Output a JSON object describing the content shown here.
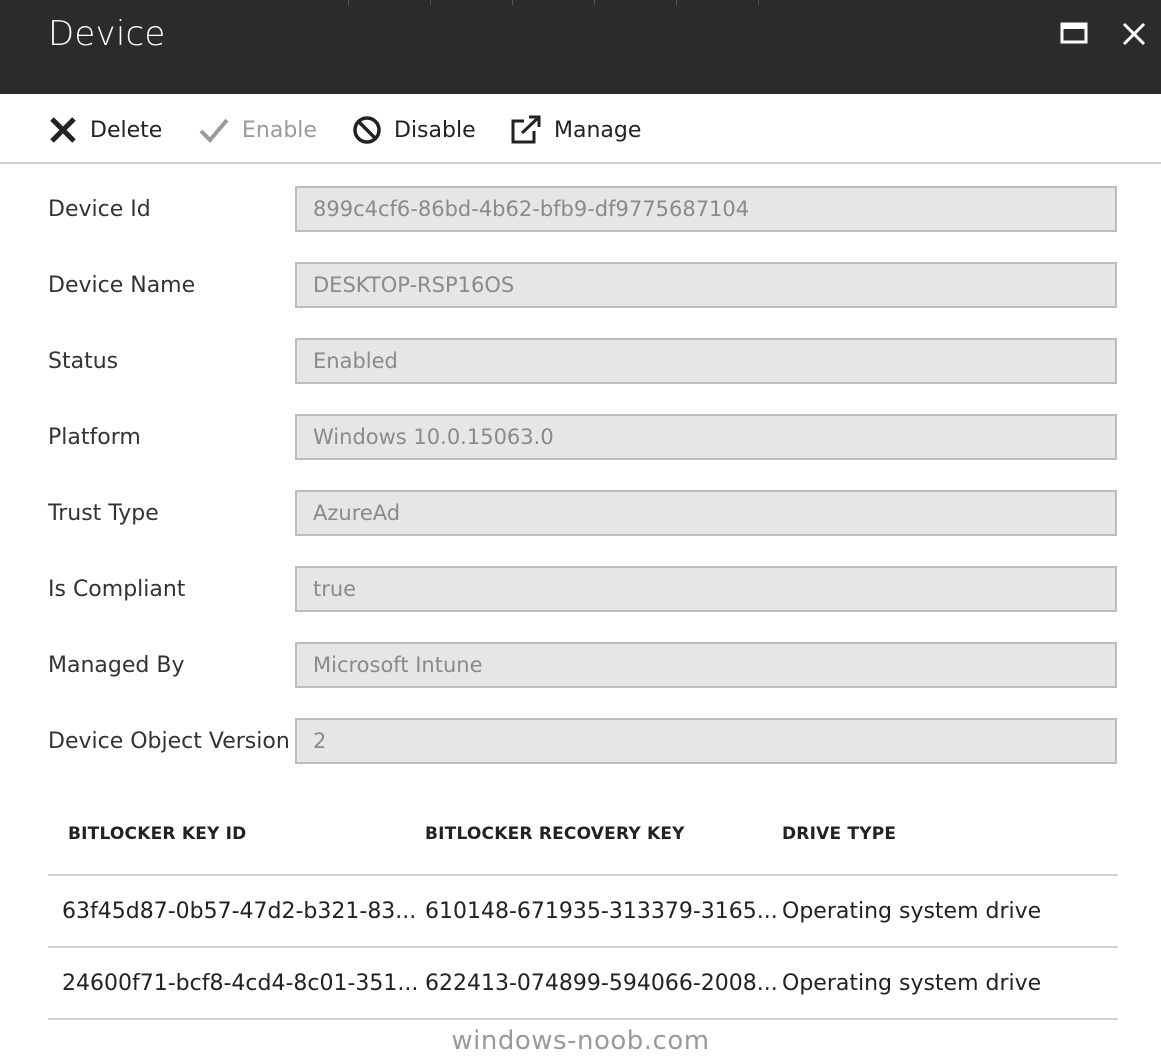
{
  "window": {
    "title": "Device",
    "maximize_icon": "maximize-icon",
    "close_icon": "close-icon"
  },
  "toolbar": {
    "delete_label": "Delete",
    "enable_label": "Enable",
    "disable_label": "Disable",
    "manage_label": "Manage"
  },
  "fields": [
    {
      "label": "Device Id",
      "value": "899c4cf6-86bd-4b62-bfb9-df9775687104"
    },
    {
      "label": "Device Name",
      "value": "DESKTOP-RSP16OS"
    },
    {
      "label": "Status",
      "value": "Enabled"
    },
    {
      "label": "Platform",
      "value": "Windows 10.0.15063.0"
    },
    {
      "label": "Trust Type",
      "value": "AzureAd"
    },
    {
      "label": "Is Compliant",
      "value": "true"
    },
    {
      "label": "Managed By",
      "value": "Microsoft Intune"
    },
    {
      "label": "Device Object Version",
      "value": "2"
    }
  ],
  "bitlocker_table": {
    "headers": [
      "BITLOCKER KEY ID",
      "BITLOCKER RECOVERY KEY",
      "DRIVE TYPE"
    ],
    "rows": [
      [
        "63f45d87-0b57-47d2-b321-83...",
        "610148-671935-313379-3165...",
        "Operating system drive"
      ],
      [
        "24600f71-bcf8-4cd4-8c01-351...",
        "622413-074899-594066-2008...",
        "Operating system drive"
      ]
    ]
  },
  "watermark": "windows-noob.com",
  "colors": {
    "titlebar_bg": "#2b2b2b",
    "field_bg": "#e6e6e6",
    "disabled_text": "#9a9a9a"
  }
}
